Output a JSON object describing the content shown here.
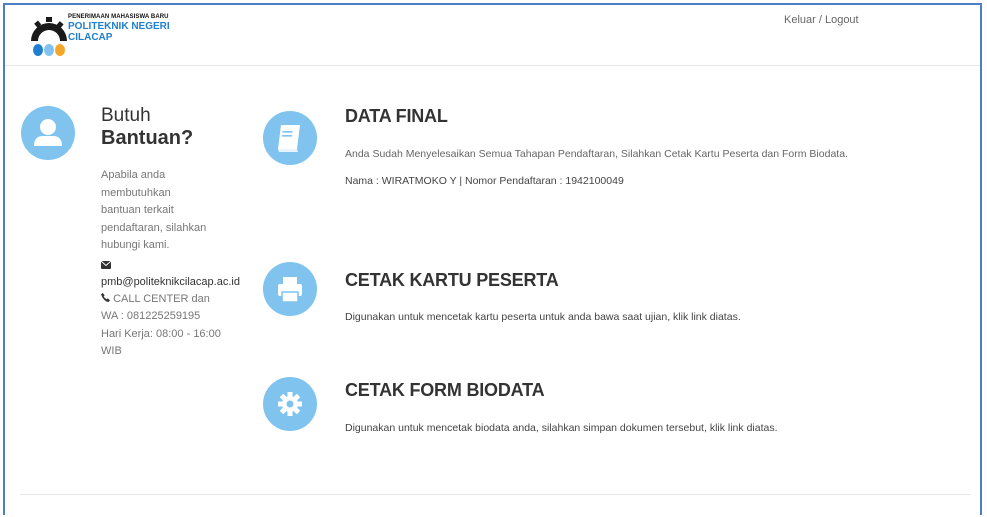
{
  "header": {
    "brand_small": "PENERIMAAN MAHASISWA BARU",
    "brand_line1": "POLITEKNIK NEGERI",
    "brand_line2": "CILACAP",
    "logout_label": "Keluar / Logout"
  },
  "help": {
    "title_light": "Butuh",
    "title_bold": "Bantuan?",
    "text_lines": [
      "Apabila anda",
      "membutuhkan",
      "bantuan terkait",
      "pendaftaran, silahkan",
      "hubungi kami."
    ],
    "email": "pmb@politeknikcilacap.ac.id",
    "call_line1": "CALL CENTER dan",
    "call_line2": "WA : 081225259195",
    "hours_line1": "Hari Kerja: 08:00 - 16:00",
    "hours_line2": "WIB"
  },
  "sections": {
    "data_final": {
      "title": "DATA FINAL",
      "description": "Anda Sudah Menyelesaikan Semua Tahapan Pendaftaran, Silahkan Cetak Kartu Peserta dan Form Biodata.",
      "detail": "Nama : WIRATMOKO Y | Nomor Pendaftaran : 1942100049"
    },
    "cetak_kartu": {
      "title": "CETAK KARTU PESERTA",
      "description": "Digunakan untuk mencetak kartu peserta untuk anda bawa saat ujian, klik link diatas."
    },
    "cetak_biodata": {
      "title": "CETAK FORM BIODATA",
      "description": "Digunakan untuk mencetak biodata anda, silahkan simpan dokumen tersebut, klik link diatas."
    }
  },
  "colors": {
    "accent": "#7fc3ee",
    "brand_blue": "#1f7fd1",
    "frame": "#4a7fc1"
  },
  "icons": {
    "help": "user-icon",
    "data_final": "book-icon",
    "cetak_kartu": "printer-icon",
    "cetak_biodata": "gear-icon",
    "email": "envelope-icon",
    "phone": "phone-icon"
  }
}
